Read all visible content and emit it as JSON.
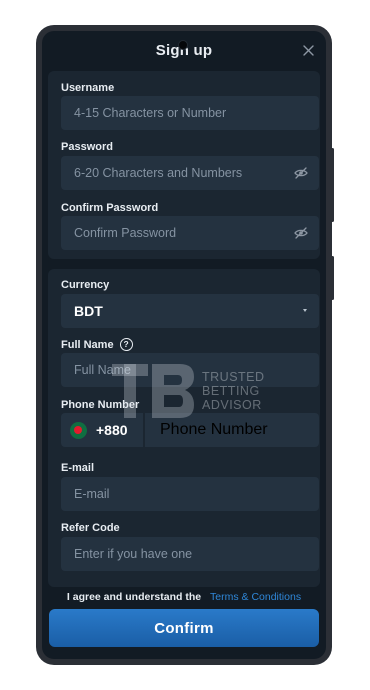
{
  "header": {
    "title": "Sign up",
    "close_icon": "close-icon"
  },
  "account": {
    "username": {
      "label": "Username",
      "placeholder": "4-15 Characters or Number"
    },
    "password": {
      "label": "Password",
      "placeholder": "6-20 Characters and Numbers"
    },
    "confirm_password": {
      "label": "Confirm Password",
      "placeholder": "Confirm Password"
    }
  },
  "profile": {
    "currency": {
      "label": "Currency",
      "value": "BDT"
    },
    "full_name": {
      "label": "Full Name",
      "placeholder": "Full Name",
      "help_glyph": "?"
    },
    "phone": {
      "label": "Phone Number",
      "country_code": "+880",
      "placeholder": "Phone Number"
    },
    "email": {
      "label": "E-mail",
      "placeholder": "E-mail"
    },
    "refer": {
      "label": "Refer Code",
      "placeholder": "Enter if you have one"
    }
  },
  "agreement": {
    "text": "I agree and understand the",
    "link": "Terms & Conditions"
  },
  "confirm_label": "Confirm",
  "watermark": {
    "line1": "TRUSTED",
    "line2": "BETTING",
    "line3": "ADVISOR"
  },
  "colors": {
    "background": "#121b24",
    "card": "#1b2631",
    "field": "#243240",
    "accent": "#2f87d8",
    "button": "#1f6bb6"
  }
}
